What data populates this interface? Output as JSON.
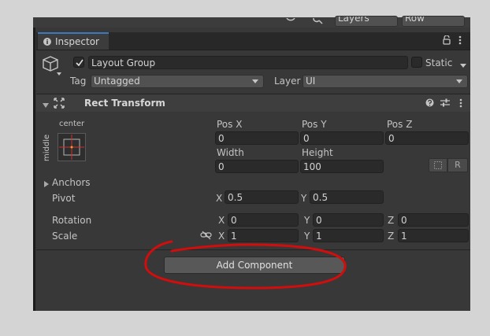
{
  "toolbar": {
    "layers_label": "Layers",
    "layout_label": "Row"
  },
  "tab": {
    "label": "Inspector"
  },
  "object": {
    "name": "Layout Group",
    "static_label": "Static",
    "tag_label": "Tag",
    "tag_value": "Untagged",
    "layer_label": "Layer",
    "layer_value": "UI"
  },
  "component": {
    "title": "Rect Transform"
  },
  "anchor_preset": {
    "horizontal": "center",
    "vertical": "middle"
  },
  "pos": {
    "x_label": "Pos X",
    "y_label": "Pos Y",
    "z_label": "Pos Z",
    "x": "0",
    "y": "0",
    "z": "0"
  },
  "size": {
    "width_label": "Width",
    "height_label": "Height",
    "width": "0",
    "height": "100",
    "raw_label": "R"
  },
  "anchors": {
    "label": "Anchors"
  },
  "pivot": {
    "label": "Pivot",
    "x_label": "X",
    "y_label": "Y",
    "x": "0.5",
    "y": "0.5"
  },
  "rotation": {
    "label": "Rotation",
    "x_label": "X",
    "y_label": "Y",
    "z_label": "Z",
    "x": "0",
    "y": "0",
    "z": "0"
  },
  "scale": {
    "label": "Scale",
    "x_label": "X",
    "y_label": "Y",
    "z_label": "Z",
    "x": "1",
    "y": "1",
    "z": "1"
  },
  "add_component": {
    "label": "Add Component"
  },
  "colors": {
    "accent": "#3a79bb",
    "panel": "#383838",
    "annotation": "#d10d0d"
  }
}
